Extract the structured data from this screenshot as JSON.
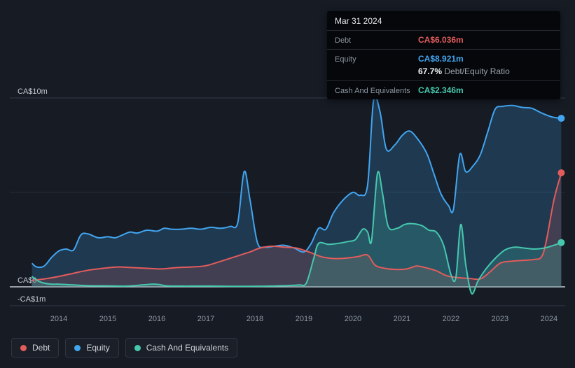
{
  "tooltip": {
    "date": "Mar 31 2024",
    "debt_label": "Debt",
    "debt_value": "CA$6.036m",
    "equity_label": "Equity",
    "equity_value": "CA$8.921m",
    "ratio_value": "67.7%",
    "ratio_label": "Debt/Equity Ratio",
    "cash_label": "Cash And Equivalents",
    "cash_value": "CA$2.346m"
  },
  "legend": {
    "items": [
      {
        "label": "Debt"
      },
      {
        "label": "Equity"
      },
      {
        "label": "Cash And Equivalents"
      }
    ]
  },
  "chart_data": {
    "type": "area",
    "title": "",
    "xlabel": "",
    "ylabel": "",
    "currency": "CA$",
    "grid": true,
    "legend_position": "bottom-left",
    "xlim": [
      2013.0,
      2024.33
    ],
    "ylim": [
      -1,
      10
    ],
    "x_ticks": [
      2014,
      2015,
      2016,
      2017,
      2018,
      2019,
      2020,
      2021,
      2022,
      2023,
      2024
    ],
    "y_ticks": [
      {
        "value": 10,
        "label": "CA$10m"
      },
      {
        "value": 5,
        "label": ""
      },
      {
        "value": 0,
        "label": "CA$0"
      },
      {
        "value": -1,
        "label": "-CA$1m"
      }
    ],
    "latest": {
      "date": "Mar 31 2024",
      "debt": 6.036,
      "equity": 8.921,
      "cash": 2.346,
      "debt_equity_ratio_pct": 67.7
    },
    "series": [
      {
        "name": "Equity",
        "color": "#42a5f0",
        "fill": "rgba(66,165,240,0.22)",
        "points": [
          [
            2013.45,
            1.25
          ],
          [
            2013.55,
            1.05
          ],
          [
            2013.7,
            1.1
          ],
          [
            2013.85,
            1.55
          ],
          [
            2014.0,
            1.9
          ],
          [
            2014.15,
            2.0
          ],
          [
            2014.3,
            1.95
          ],
          [
            2014.45,
            2.75
          ],
          [
            2014.6,
            2.8
          ],
          [
            2014.8,
            2.6
          ],
          [
            2015.0,
            2.65
          ],
          [
            2015.15,
            2.6
          ],
          [
            2015.3,
            2.75
          ],
          [
            2015.45,
            2.9
          ],
          [
            2015.6,
            2.85
          ],
          [
            2015.8,
            3.0
          ],
          [
            2016.0,
            2.95
          ],
          [
            2016.15,
            3.1
          ],
          [
            2016.3,
            3.05
          ],
          [
            2016.5,
            3.05
          ],
          [
            2016.7,
            3.1
          ],
          [
            2016.9,
            3.05
          ],
          [
            2017.1,
            3.15
          ],
          [
            2017.3,
            3.1
          ],
          [
            2017.5,
            3.2
          ],
          [
            2017.65,
            3.4
          ],
          [
            2017.78,
            6.1
          ],
          [
            2017.9,
            4.6
          ],
          [
            2018.05,
            2.35
          ],
          [
            2018.2,
            2.1
          ],
          [
            2018.4,
            2.15
          ],
          [
            2018.6,
            2.2
          ],
          [
            2018.8,
            2.05
          ],
          [
            2019.0,
            1.85
          ],
          [
            2019.15,
            2.3
          ],
          [
            2019.3,
            3.1
          ],
          [
            2019.45,
            3.05
          ],
          [
            2019.6,
            3.9
          ],
          [
            2019.8,
            4.6
          ],
          [
            2020.0,
            5.0
          ],
          [
            2020.15,
            4.85
          ],
          [
            2020.3,
            5.4
          ],
          [
            2020.42,
            9.85
          ],
          [
            2020.55,
            9.3
          ],
          [
            2020.68,
            7.3
          ],
          [
            2020.85,
            7.5
          ],
          [
            2021.0,
            8.0
          ],
          [
            2021.15,
            8.25
          ],
          [
            2021.3,
            7.9
          ],
          [
            2021.5,
            7.1
          ],
          [
            2021.65,
            6.0
          ],
          [
            2021.8,
            4.9
          ],
          [
            2021.95,
            4.3
          ],
          [
            2022.05,
            4.1
          ],
          [
            2022.18,
            7.0
          ],
          [
            2022.3,
            6.1
          ],
          [
            2022.45,
            6.4
          ],
          [
            2022.6,
            7.0
          ],
          [
            2022.75,
            8.2
          ],
          [
            2022.9,
            9.4
          ],
          [
            2023.05,
            9.55
          ],
          [
            2023.25,
            9.6
          ],
          [
            2023.45,
            9.5
          ],
          [
            2023.65,
            9.45
          ],
          [
            2023.85,
            9.2
          ],
          [
            2024.05,
            9.0
          ],
          [
            2024.25,
            8.921
          ]
        ]
      },
      {
        "name": "Debt",
        "color": "#e25c5c",
        "fill": "rgba(226,92,92,0.18)",
        "points": [
          [
            2013.45,
            0.35
          ],
          [
            2013.7,
            0.42
          ],
          [
            2014.0,
            0.55
          ],
          [
            2014.3,
            0.72
          ],
          [
            2014.6,
            0.88
          ],
          [
            2014.9,
            0.98
          ],
          [
            2015.2,
            1.05
          ],
          [
            2015.5,
            1.02
          ],
          [
            2015.8,
            0.98
          ],
          [
            2016.1,
            0.95
          ],
          [
            2016.4,
            1.02
          ],
          [
            2016.7,
            1.05
          ],
          [
            2017.0,
            1.12
          ],
          [
            2017.3,
            1.35
          ],
          [
            2017.6,
            1.6
          ],
          [
            2017.9,
            1.85
          ],
          [
            2018.1,
            2.05
          ],
          [
            2018.35,
            2.15
          ],
          [
            2018.6,
            2.1
          ],
          [
            2018.85,
            2.05
          ],
          [
            2019.1,
            1.85
          ],
          [
            2019.35,
            1.6
          ],
          [
            2019.6,
            1.5
          ],
          [
            2019.85,
            1.52
          ],
          [
            2020.1,
            1.6
          ],
          [
            2020.3,
            1.68
          ],
          [
            2020.45,
            1.15
          ],
          [
            2020.65,
            0.98
          ],
          [
            2020.9,
            0.92
          ],
          [
            2021.1,
            0.95
          ],
          [
            2021.3,
            1.1
          ],
          [
            2021.5,
            1.0
          ],
          [
            2021.7,
            0.85
          ],
          [
            2021.9,
            0.6
          ],
          [
            2022.1,
            0.5
          ],
          [
            2022.35,
            0.45
          ],
          [
            2022.6,
            0.42
          ],
          [
            2022.8,
            0.8
          ],
          [
            2023.0,
            1.25
          ],
          [
            2023.2,
            1.35
          ],
          [
            2023.45,
            1.4
          ],
          [
            2023.7,
            1.45
          ],
          [
            2023.85,
            1.6
          ],
          [
            2023.95,
            2.5
          ],
          [
            2024.1,
            4.6
          ],
          [
            2024.25,
            6.036
          ]
        ]
      },
      {
        "name": "Cash And Equivalents",
        "color": "#46c8ae",
        "fill": "rgba(70,200,174,0.22)",
        "points": [
          [
            2013.45,
            0.55
          ],
          [
            2013.6,
            0.28
          ],
          [
            2013.8,
            0.15
          ],
          [
            2014.0,
            0.14
          ],
          [
            2014.3,
            0.1
          ],
          [
            2014.6,
            0.06
          ],
          [
            2015.0,
            0.05
          ],
          [
            2015.4,
            0.04
          ],
          [
            2015.7,
            0.1
          ],
          [
            2015.9,
            0.14
          ],
          [
            2016.05,
            0.12
          ],
          [
            2016.2,
            0.05
          ],
          [
            2016.5,
            0.04
          ],
          [
            2016.8,
            0.04
          ],
          [
            2017.1,
            0.04
          ],
          [
            2017.5,
            0.03
          ],
          [
            2017.9,
            0.03
          ],
          [
            2018.3,
            0.04
          ],
          [
            2018.6,
            0.06
          ],
          [
            2018.9,
            0.1
          ],
          [
            2019.05,
            0.2
          ],
          [
            2019.2,
            1.5
          ],
          [
            2019.3,
            2.3
          ],
          [
            2019.5,
            2.25
          ],
          [
            2019.7,
            2.3
          ],
          [
            2019.9,
            2.4
          ],
          [
            2020.05,
            2.5
          ],
          [
            2020.2,
            3.05
          ],
          [
            2020.3,
            2.9
          ],
          [
            2020.38,
            2.45
          ],
          [
            2020.5,
            6.0
          ],
          [
            2020.6,
            5.0
          ],
          [
            2020.72,
            3.2
          ],
          [
            2020.9,
            3.1
          ],
          [
            2021.05,
            3.3
          ],
          [
            2021.2,
            3.35
          ],
          [
            2021.4,
            3.25
          ],
          [
            2021.55,
            3.0
          ],
          [
            2021.7,
            2.9
          ],
          [
            2021.85,
            2.2
          ],
          [
            2022.0,
            0.65
          ],
          [
            2022.1,
            0.5
          ],
          [
            2022.2,
            3.3
          ],
          [
            2022.3,
            1.2
          ],
          [
            2022.42,
            -0.35
          ],
          [
            2022.55,
            0.3
          ],
          [
            2022.7,
            0.9
          ],
          [
            2022.9,
            1.5
          ],
          [
            2023.1,
            1.95
          ],
          [
            2023.3,
            2.1
          ],
          [
            2023.5,
            2.05
          ],
          [
            2023.7,
            2.0
          ],
          [
            2023.9,
            2.05
          ],
          [
            2024.1,
            2.2
          ],
          [
            2024.25,
            2.346
          ]
        ]
      }
    ]
  }
}
